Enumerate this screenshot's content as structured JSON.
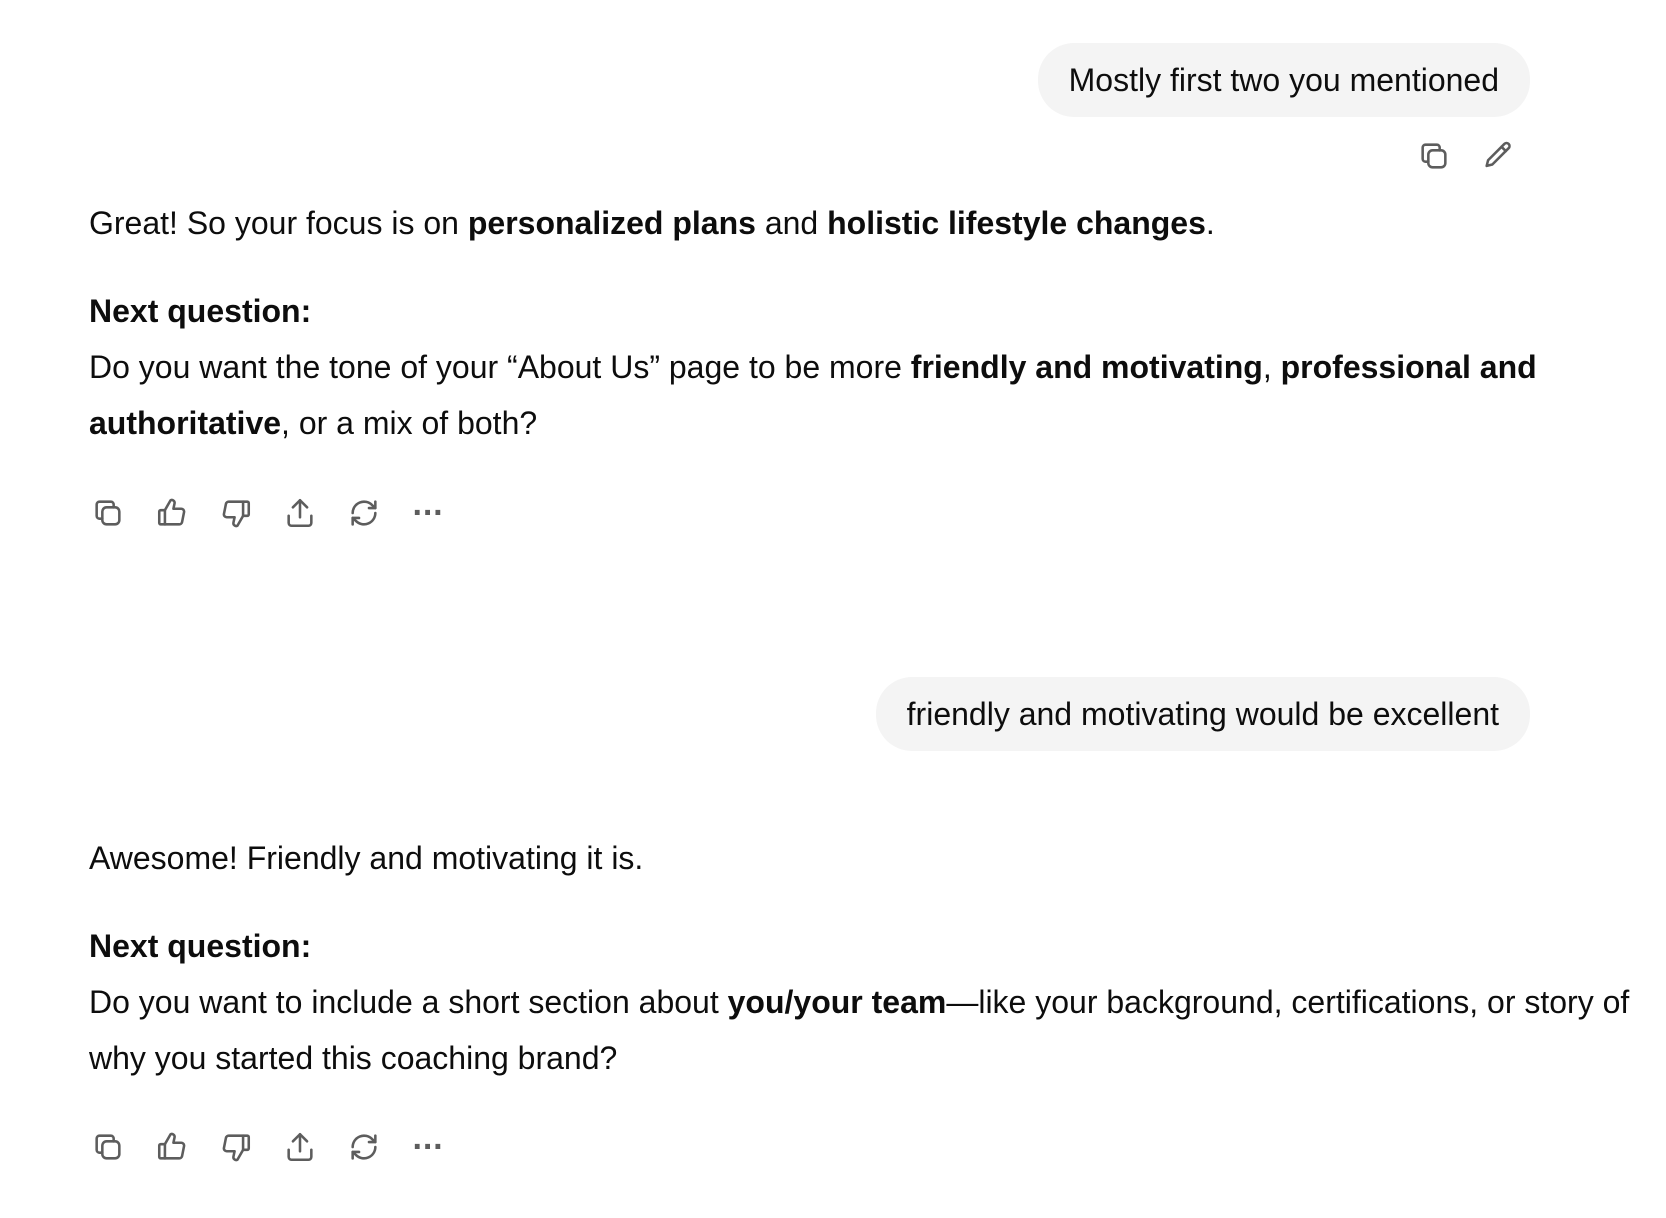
{
  "messages": [
    {
      "role": "user",
      "text": "Mostly first two you mentioned"
    },
    {
      "role": "assistant",
      "intro": {
        "t1": "Great! So your focus is on ",
        "b1": "personalized plans",
        "t2": " and ",
        "b2": "holistic lifestyle changes",
        "t3": "."
      },
      "next_label": "Next question:",
      "question": {
        "t1": "Do you want the tone of your “About Us” page to be more ",
        "b1": "friendly and motivating",
        "t2": ", ",
        "b2": "professional and authoritative",
        "t3": ", or a mix of both?"
      }
    },
    {
      "role": "user",
      "text": "friendly and motivating would be excellent"
    },
    {
      "role": "assistant",
      "intro": {
        "t1": "Awesome! Friendly and motivating it is."
      },
      "next_label": "Next question:",
      "question": {
        "t1": "Do you want to include a short section about ",
        "b1": "you/your team",
        "t2": "—like your background, certifications, or story of why you started this coaching brand?"
      }
    }
  ],
  "icons": {
    "user_actions": [
      "copy-icon",
      "edit-pencil-icon"
    ],
    "assistant_actions": [
      "copy-icon",
      "thumbs-up-icon",
      "thumbs-down-icon",
      "share-icon",
      "regenerate-icon",
      "more-icon"
    ]
  },
  "more_glyph": "···",
  "colors": {
    "bubble_bg": "#f4f4f4",
    "text": "#0d0d0d",
    "icon": "#5d5d5d"
  }
}
